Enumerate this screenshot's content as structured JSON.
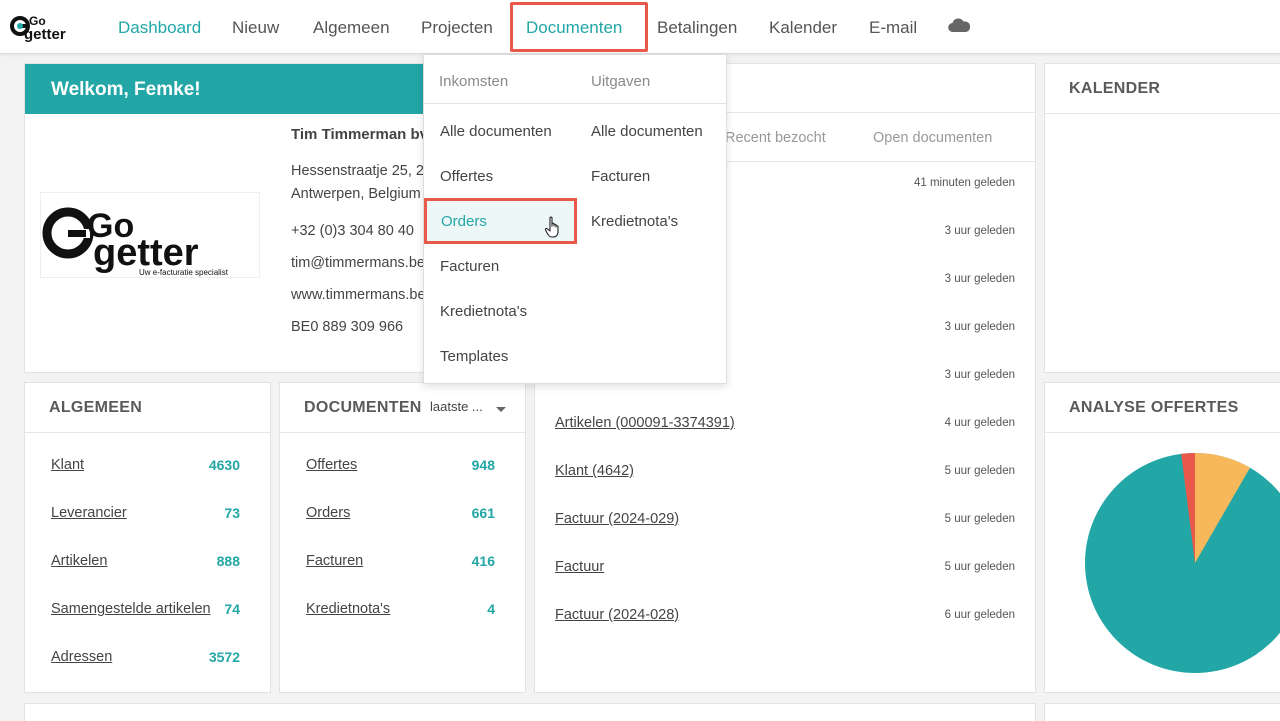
{
  "nav": {
    "logo_text": "GoGetter",
    "items": [
      {
        "label": "Dashboard"
      },
      {
        "label": "Nieuw"
      },
      {
        "label": "Algemeen"
      },
      {
        "label": "Projecten"
      },
      {
        "label": "Documenten"
      },
      {
        "label": "Betalingen"
      },
      {
        "label": "Kalender"
      },
      {
        "label": "E-mail"
      }
    ],
    "cloud_icon": "cloud-icon"
  },
  "welcome": {
    "title": "Welkom, Femke!",
    "company": {
      "name": "Tim Timmerman bv",
      "address1": "Hessenstraatje 25, 2",
      "address2": "Antwerpen, Belgium",
      "phone": "+32 (0)3 304 80 40",
      "email": "tim@timmermans.be",
      "website": "www.timmermans.be",
      "vat": "BE0 889 309 966"
    },
    "logo": {
      "line1": "Go",
      "line2": "getter",
      "tagline": "Uw e-facturatie specialist"
    }
  },
  "recent": {
    "tabs": [
      "Recent bezocht",
      "Open documenten"
    ],
    "rows": [
      {
        "label": "",
        "time": "41 minuten geleden"
      },
      {
        "label": "",
        "time": "3 uur geleden"
      },
      {
        "label": "",
        "time": "3 uur geleden"
      },
      {
        "label": "",
        "time": "3 uur geleden"
      },
      {
        "label": "",
        "time": "3 uur geleden"
      },
      {
        "label": "Artikelen (000091-3374391)",
        "time": "4 uur geleden"
      },
      {
        "label": "Klant (4642)",
        "time": "5 uur geleden"
      },
      {
        "label": "Factuur (2024-029)",
        "time": "5 uur geleden"
      },
      {
        "label": "Factuur",
        "time": "5 uur geleden"
      },
      {
        "label": "Factuur (2024-028)",
        "time": "6 uur geleden"
      }
    ]
  },
  "kalender": {
    "title": "KALENDER"
  },
  "algemeen": {
    "title": "ALGEMEEN",
    "rows": [
      {
        "label": "Klant",
        "count": "4630"
      },
      {
        "label": "Leverancier",
        "count": "73"
      },
      {
        "label": "Artikelen",
        "count": "888"
      },
      {
        "label": "Samengestelde artikelen",
        "count": "74"
      },
      {
        "label": "Adressen",
        "count": "3572"
      }
    ]
  },
  "documenten": {
    "title": "DOCUMENTEN",
    "period": "laatste ...",
    "rows": [
      {
        "label": "Offertes",
        "count": "948"
      },
      {
        "label": "Orders",
        "count": "661"
      },
      {
        "label": "Facturen",
        "count": "416"
      },
      {
        "label": "Kredietnota's",
        "count": "4"
      }
    ]
  },
  "analyse": {
    "title": "ANALYSE OFFERTES"
  },
  "dropdown": {
    "inkomsten": {
      "title": "Inkomsten",
      "items": [
        "Alle documenten",
        "Offertes",
        "Orders",
        "Facturen",
        "Kredietnota's",
        "Templates"
      ]
    },
    "uitgaven": {
      "title": "Uitgaven",
      "items": [
        "Alle documenten",
        "Facturen",
        "Kredietnota's"
      ]
    }
  },
  "colors": {
    "accent": "#22a6a6",
    "highlight": "#e8594a",
    "pie_orange": "#f6b85b",
    "pie_red": "#e8594a"
  }
}
